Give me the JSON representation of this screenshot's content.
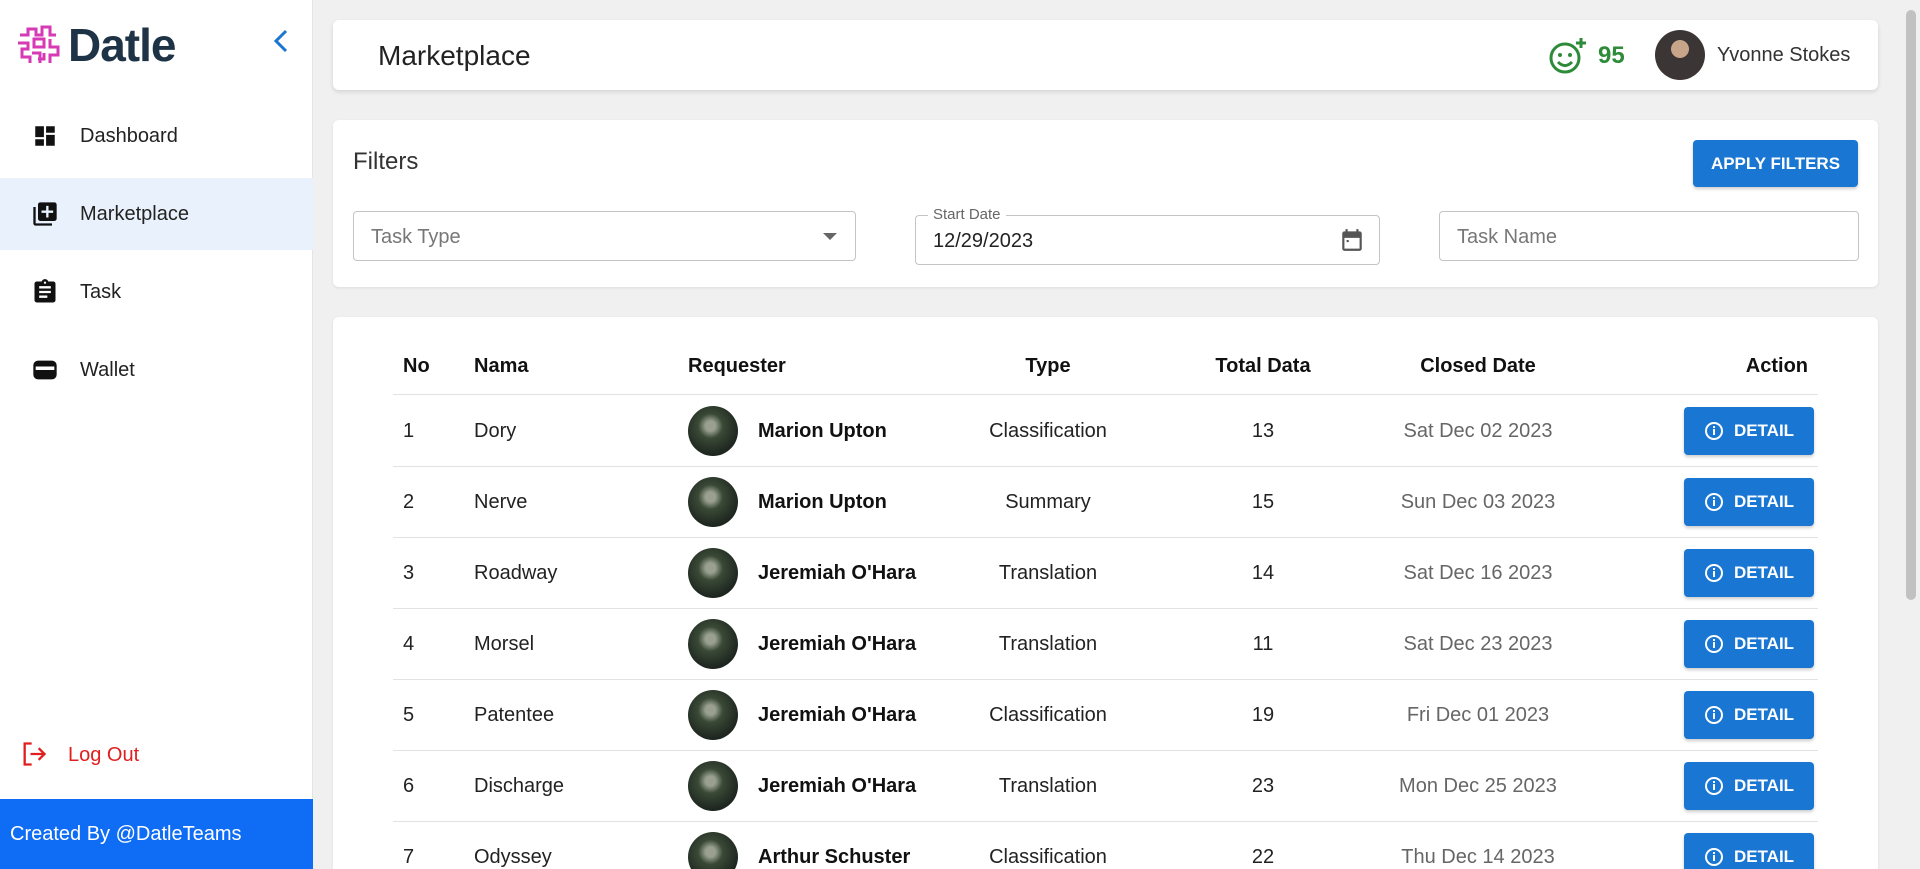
{
  "brand": {
    "name": "Datle",
    "logo_icon": "maze-logo",
    "accent": "#d63ab5"
  },
  "sidebar": {
    "items": [
      {
        "label": "Dashboard",
        "icon": "dashboard-icon"
      },
      {
        "label": "Marketplace",
        "icon": "add-box-icon",
        "active": true
      },
      {
        "label": "Task",
        "icon": "clipboard-icon"
      },
      {
        "label": "Wallet",
        "icon": "wallet-icon"
      }
    ],
    "logout_label": "Log Out",
    "footer": "Created By @DatleTeams"
  },
  "header": {
    "title": "Marketplace",
    "score": "95",
    "user_name": "Yvonne Stokes"
  },
  "filters": {
    "title": "Filters",
    "apply_label": "APPLY FILTERS",
    "task_type_placeholder": "Task Type",
    "start_date_label": "Start Date",
    "start_date_value": "12/29/2023",
    "task_name_placeholder": "Task Name"
  },
  "table": {
    "headers": {
      "no": "No",
      "nama": "Nama",
      "requester": "Requester",
      "type": "Type",
      "total": "Total Data",
      "closed": "Closed Date",
      "action": "Action"
    },
    "detail_label": "DETAIL",
    "rows": [
      {
        "no": "1",
        "nama": "Dory",
        "requester": "Marion Upton",
        "type": "Classification",
        "total": "13",
        "closed": "Sat Dec 02 2023"
      },
      {
        "no": "2",
        "nama": "Nerve",
        "requester": "Marion Upton",
        "type": "Summary",
        "total": "15",
        "closed": "Sun Dec 03 2023"
      },
      {
        "no": "3",
        "nama": "Roadway",
        "requester": "Jeremiah O'Hara",
        "type": "Translation",
        "total": "14",
        "closed": "Sat Dec 16 2023"
      },
      {
        "no": "4",
        "nama": "Morsel",
        "requester": "Jeremiah O'Hara",
        "type": "Translation",
        "total": "11",
        "closed": "Sat Dec 23 2023"
      },
      {
        "no": "5",
        "nama": "Patentee",
        "requester": "Jeremiah O'Hara",
        "type": "Classification",
        "total": "19",
        "closed": "Fri Dec 01 2023"
      },
      {
        "no": "6",
        "nama": "Discharge",
        "requester": "Jeremiah O'Hara",
        "type": "Translation",
        "total": "23",
        "closed": "Mon Dec 25 2023"
      },
      {
        "no": "7",
        "nama": "Odyssey",
        "requester": "Arthur Schuster",
        "type": "Classification",
        "total": "22",
        "closed": "Thu Dec 14 2023"
      }
    ]
  },
  "colors": {
    "primary": "#1976d2",
    "footer": "#0f6cf5",
    "logout": "#e02020",
    "score": "#2e8b3a"
  }
}
